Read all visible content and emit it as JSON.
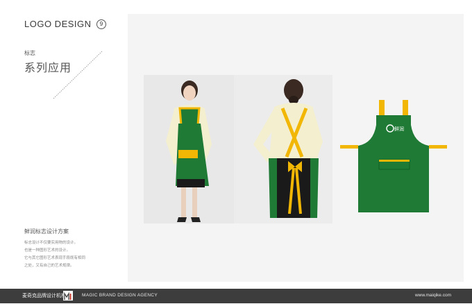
{
  "header": {
    "title": "LOGO DESIGN",
    "page_number": "9"
  },
  "section": {
    "label_small": "标志",
    "label_big": "系列应用"
  },
  "description": {
    "title": "鲜润标志设计方案",
    "lines": [
      "标志设计不仅要实用物的设计。",
      "也是一种图形艺术的设计。",
      "它与其它图形艺术表现手段既有相同",
      "之处，又有自己的艺术规律。"
    ]
  },
  "apron": {
    "brand_text": "鲜润",
    "colors": {
      "green": "#1f7a35",
      "yellow": "#f2b705",
      "shirt": "#f4efcf"
    }
  },
  "footer": {
    "agency_cn": "麦奇克品牌设计机构",
    "agency_en": "MAGIC BRAND DESIGN AGENCY",
    "url": "www.maiqike.com"
  }
}
